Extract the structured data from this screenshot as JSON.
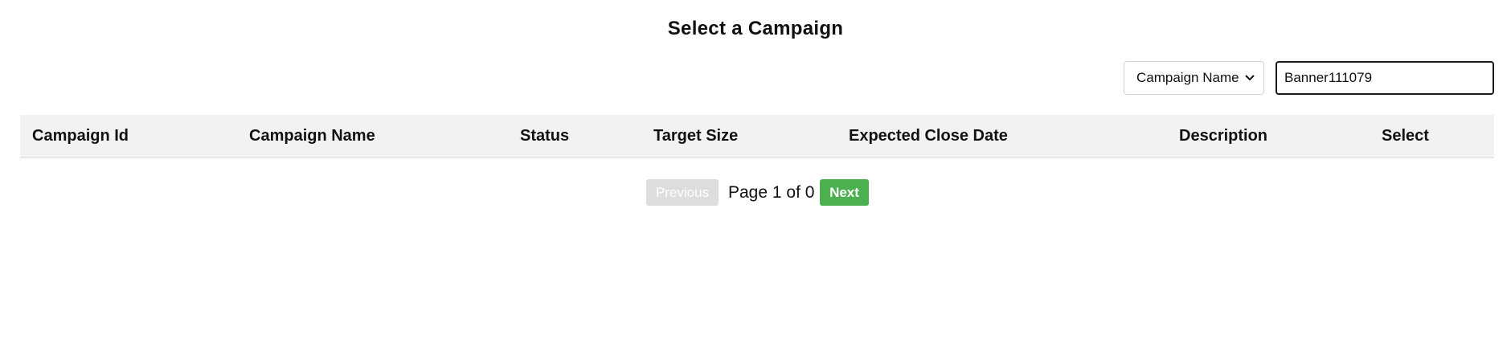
{
  "page": {
    "title": "Select a Campaign"
  },
  "filter": {
    "selected": "Campaign Name",
    "icon": "chevron-down-icon"
  },
  "search": {
    "value": "Banner111079",
    "placeholder": ""
  },
  "table": {
    "columns": [
      "Campaign Id",
      "Campaign Name",
      "Status",
      "Target Size",
      "Expected Close Date",
      "Description",
      "Select"
    ],
    "rows": []
  },
  "pagination": {
    "previous_label": "Previous",
    "page_info": "Page 1 of 0",
    "next_label": "Next"
  },
  "colors": {
    "next_button": "#4caf50",
    "previous_button_disabled": "#dddddd",
    "header_background": "#f2f2f2"
  }
}
